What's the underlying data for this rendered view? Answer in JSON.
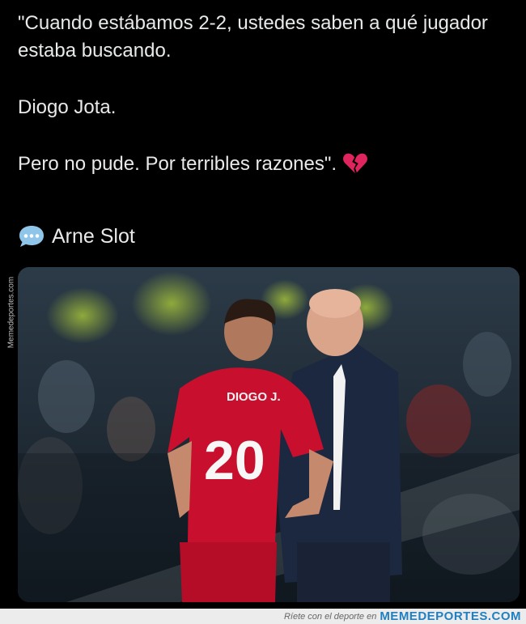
{
  "tweet": {
    "line1": "\"Cuando estábamos 2-2, ustedes saben a qué jugador estaba buscando.",
    "line2": "Diogo Jota.",
    "line3": "Pero no pude. Por terribles razones\".",
    "heart_icon": "broken-heart-icon",
    "author": "Arne Slot",
    "author_icon": "speech-bubble-icon"
  },
  "photo": {
    "shirt_name": "DIOGO J.",
    "shirt_number": "20"
  },
  "watermark": {
    "side_text": "Memedeportes.com",
    "footer_tagline": "Ríete con el deporte en",
    "footer_brand": "MEMEDEPORTES.COM"
  },
  "colors": {
    "background": "#000000",
    "text": "#e7e9ea",
    "jersey_red": "#c8102e",
    "coat_navy": "#1c2740",
    "brand_blue": "#1f7fc1"
  }
}
